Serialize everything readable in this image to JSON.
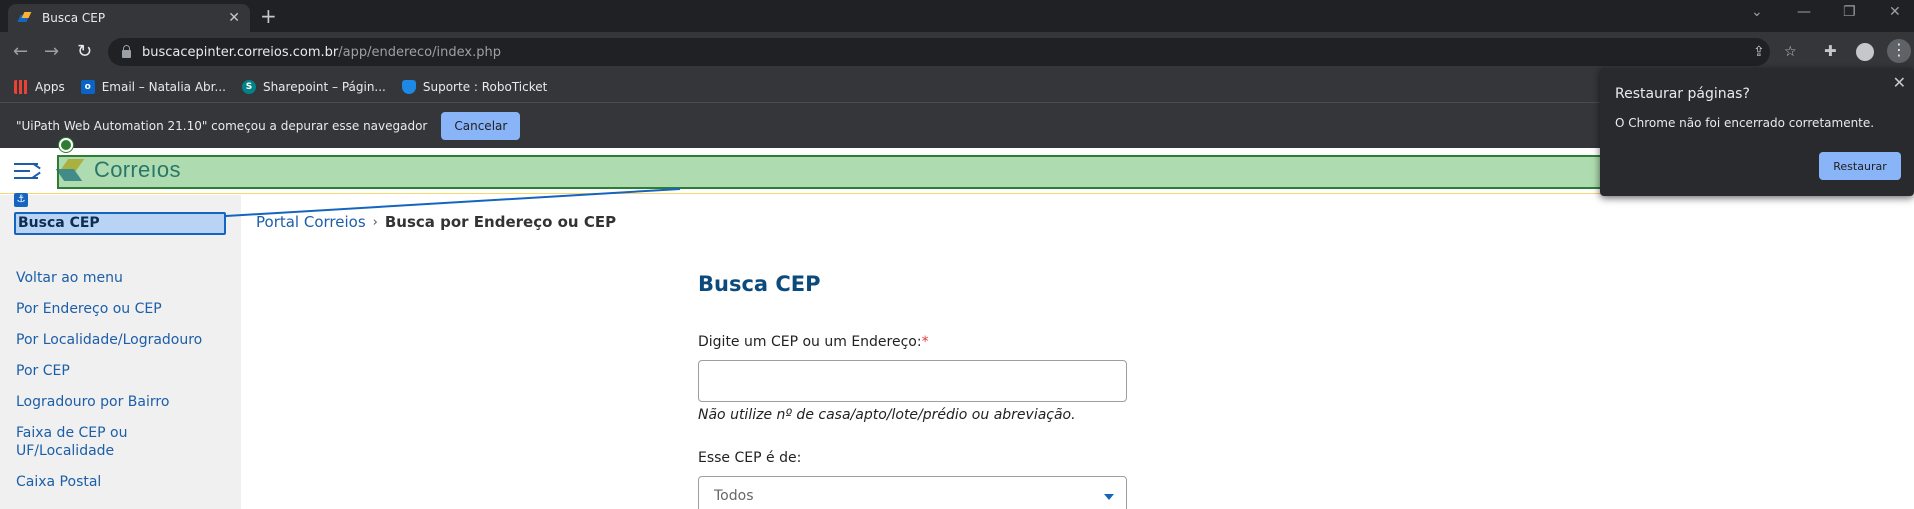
{
  "browser": {
    "tab": {
      "title": "Busca CEP"
    },
    "address": {
      "host": "buscacepinter.correios.com.br",
      "path": "/app/endereco/index.php"
    },
    "bookmarks": [
      {
        "label": "Apps"
      },
      {
        "label": "Email – Natalia Abr..."
      },
      {
        "label": "Sharepoint – Págin..."
      },
      {
        "label": "Suporte : RoboTicket"
      }
    ],
    "infobar": {
      "message": "\"UiPath Web Automation 21.10\" começou a depurar esse navegador",
      "cancel_label": "Cancelar"
    },
    "restore_popup": {
      "title": "Restaurar páginas?",
      "body": "O Chrome não foi encerrado corretamente.",
      "button_label": "Restaurar"
    }
  },
  "page": {
    "logo_text": "Correıos",
    "sidebar": {
      "title": "Busca CEP",
      "items": [
        {
          "label": "Voltar ao menu"
        },
        {
          "label": "Por Endereço ou CEP"
        },
        {
          "label": "Por Localidade/Logradouro"
        },
        {
          "label": "Por CEP"
        },
        {
          "label": "Logradouro por Bairro"
        },
        {
          "label": "Faixa de CEP ou UF/Localidade"
        },
        {
          "label": "Caixa Postal"
        }
      ]
    },
    "breadcrumb": {
      "root": "Portal Correios",
      "separator": "›",
      "current": "Busca por Endereço ou CEP"
    },
    "form": {
      "title": "Busca CEP",
      "cep_label": "Digite um CEP ou um Endereço:",
      "required_mark": "*",
      "cep_value": "",
      "hint": "Não utilize nº de casa/apto/lote/prédio ou abreviação.",
      "type_label": "Esse CEP é de:",
      "type_selected": "Todos"
    }
  },
  "colors": {
    "brand_blue": "#0b4a7d",
    "link_blue": "#1c5ea8",
    "brand_yellow": "#f9b233",
    "highlight_green": "#2e7d32",
    "anchor_blue": "#1565c0"
  }
}
